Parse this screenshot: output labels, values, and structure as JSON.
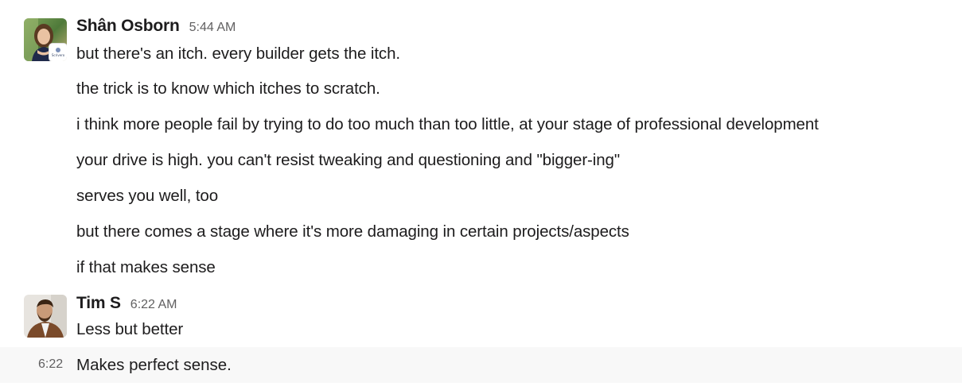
{
  "messages": [
    {
      "sender": "Shân Osborn",
      "time": "5:44 AM",
      "avatar_icon": "user-photo-avatar-woman",
      "avatar_badge_text": "Scrivero",
      "lines": [
        "but there's an itch. every builder gets the itch.",
        "the trick is to know which itches to scratch.",
        "i think more people fail by trying to do too much than too little, at your stage of professional development",
        "your drive is high. you can't resist tweaking and questioning and \"bigger-ing\"",
        "serves you well, too",
        "but there comes a stage where it's more damaging in certain projects/aspects",
        "if that makes sense"
      ]
    },
    {
      "sender": "Tim S",
      "time": "6:22 AM",
      "avatar_icon": "user-photo-avatar-man",
      "lines": [
        "Less but better"
      ]
    }
  ],
  "continuation": {
    "time": "6:22",
    "text": "Makes perfect sense."
  },
  "colors": {
    "text": "#1d1c1d",
    "timestamp": "#616061",
    "hover_background": "#f8f8f8"
  }
}
